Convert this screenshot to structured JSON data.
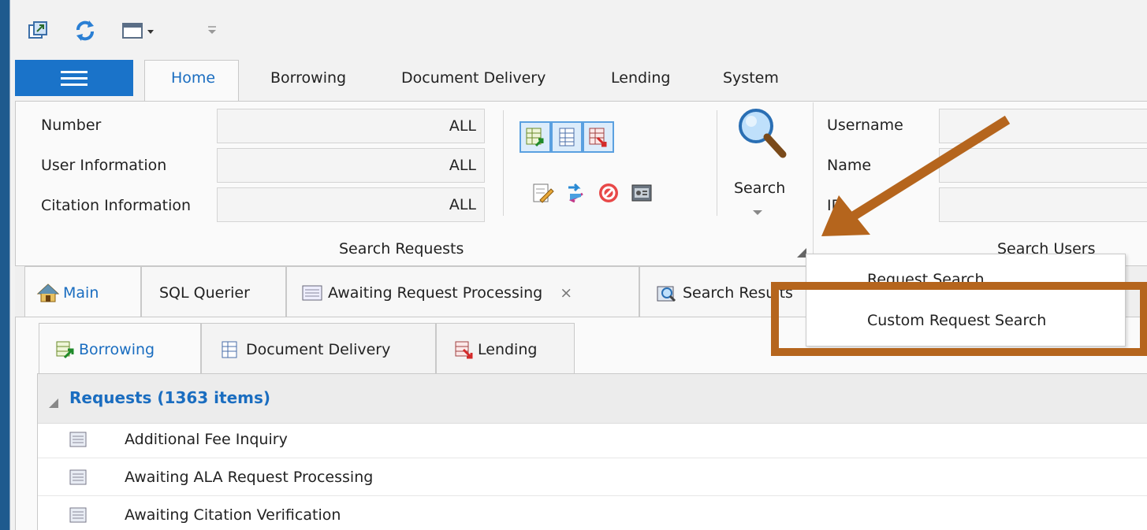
{
  "quick_access": {
    "icons": [
      "new-window-icon",
      "refresh-icon",
      "new-document-icon",
      "customize-toolbar-icon"
    ]
  },
  "ribbon_tabs": [
    "Home",
    "Borrowing",
    "Document Delivery",
    "Lending",
    "System"
  ],
  "search_requests": {
    "rows": [
      {
        "label": "Number",
        "value": "ALL"
      },
      {
        "label": "User Information",
        "value": "ALL"
      },
      {
        "label": "Citation Information",
        "value": "ALL"
      }
    ],
    "group_label": "Search Requests",
    "search_label": "Search"
  },
  "search_users": {
    "rows": [
      {
        "label": "Username"
      },
      {
        "label": "Name"
      },
      {
        "label": "ID"
      }
    ],
    "group_label": "Search Users"
  },
  "doc_tabs": {
    "main": "Main",
    "sql": "SQL Querier",
    "awaiting": "Awaiting Request Processing",
    "close": "×",
    "results": "Search Results"
  },
  "sub_tabs": [
    "Borrowing",
    "Document Delivery",
    "Lending"
  ],
  "grid": {
    "header": "Requests  (1363 items)",
    "rows": [
      "Additional Fee Inquiry",
      "Awaiting ALA Request Processing",
      "Awaiting Citation Verification"
    ]
  },
  "search_menu": {
    "items": [
      "Request Search",
      "Custom Request Search"
    ]
  },
  "colors": {
    "accent": "#1a73c9",
    "annotation": "#b5651d",
    "border_bg": "#1e5a8e"
  }
}
